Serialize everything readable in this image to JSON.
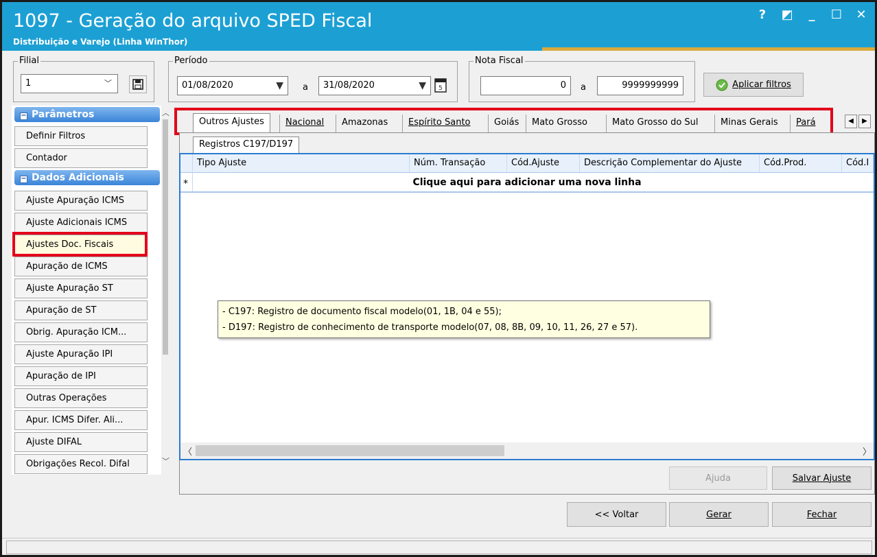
{
  "window": {
    "title": "1097 - Geração do arquivo SPED Fiscal",
    "subtitle": "Distribuição e Varejo (Linha WinThor)",
    "controls": [
      "?",
      "◩",
      "_",
      "☐",
      "✕"
    ]
  },
  "filters": {
    "filial": {
      "legend": "Filial",
      "value": "1"
    },
    "periodo": {
      "legend": "Período",
      "from": "01/08/2020",
      "sep": "a",
      "to": "31/08/2020"
    },
    "nota_fiscal": {
      "legend": "Nota Fiscal",
      "from": "0",
      "sep": "a",
      "to": "9999999999"
    },
    "apply_label": "Aplicar filtros"
  },
  "sidebar": {
    "section1": "Parâmetros",
    "section1_items": [
      "Definir Filtros",
      "Contador"
    ],
    "section2": "Dados Adicionais",
    "section2_items": [
      "Ajuste Apuração ICMS",
      "Ajuste Adicionais ICMS",
      "Ajustes Doc. Fiscais",
      "Apuração de ICMS",
      "Ajuste Apuração ST",
      "Apuração de ST",
      "Obrig. Apuração ICM...",
      "Ajuste Apuração IPI",
      "Apuração de IPI",
      "Outras Operações",
      "Apur. ICMS Difer. Ali...",
      "Ajuste DIFAL",
      "Obrigações Recol. Difal"
    ],
    "active_item": "Ajustes Doc. Fiscais"
  },
  "tabs": [
    "Outros Ajustes",
    "Nacional",
    "Amazonas",
    "Espírito Santo",
    "Goiás",
    "Mato Grosso",
    "Mato Grosso do Sul",
    "Minas Gerais",
    "Pará"
  ],
  "active_tab": "Outros Ajustes",
  "subtab": "Registros C197/D197",
  "grid": {
    "columns": [
      "Tipo Ajuste",
      "Núm. Transação",
      "Cód.Ajuste",
      "Descrição Complementar do Ajuste",
      "Cód.Prod.",
      "Cód.I"
    ],
    "new_row_marker": "*",
    "new_row_text": "Clique aqui para adicionar uma nova linha"
  },
  "tooltip": {
    "lines": [
      "- C197: Registro de documento fiscal modelo(01, 1B, 04 e 55);",
      "- D197: Registro de conhecimento de transporte modelo(07, 08, 8B, 09, 10, 11, 26, 27 e 57)."
    ]
  },
  "buttons": {
    "ajuda": "Ajuda",
    "salvar": "Salvar Ajuste",
    "voltar": "<< Voltar",
    "gerar": "Gerar",
    "fechar": "Fechar"
  },
  "colors": {
    "titlebar": "#1ca0d4",
    "highlight": "#e3001b",
    "section_header": "#3a84d9"
  }
}
